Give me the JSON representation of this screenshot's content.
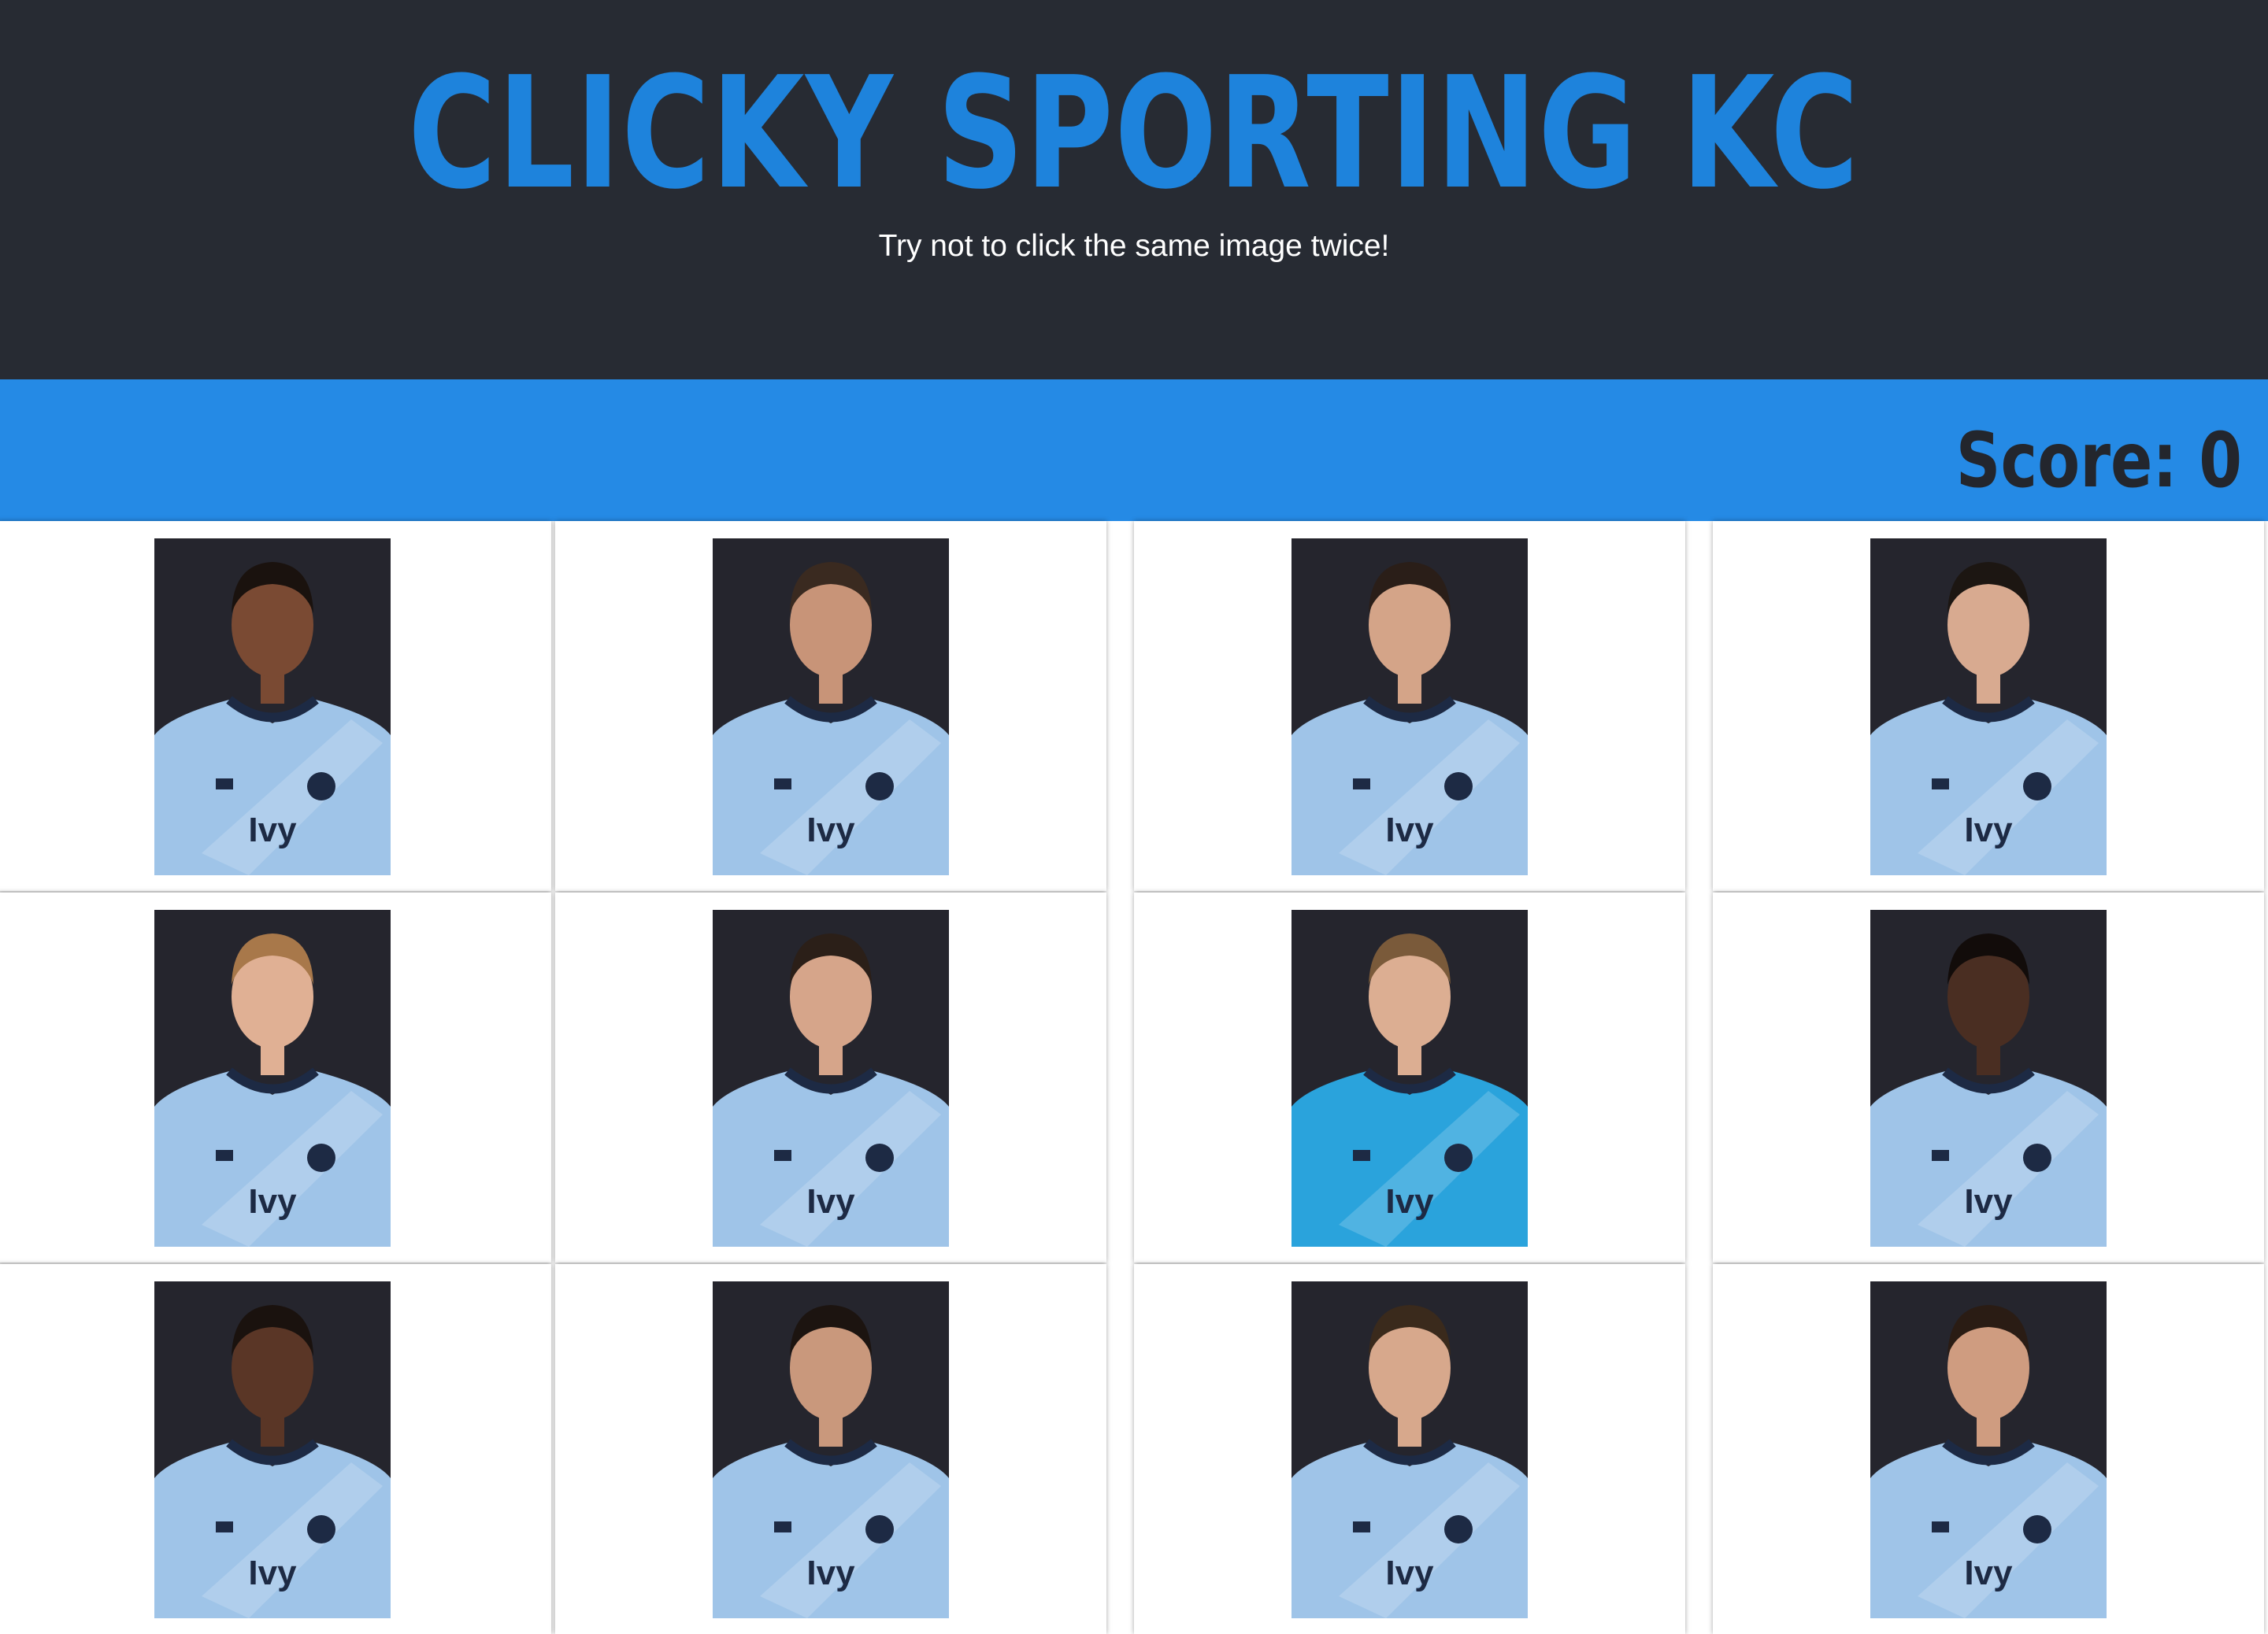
{
  "header": {
    "title": "CLICKY SPORTING KC",
    "subtitle": "Try not to click the same image twice!"
  },
  "scorebar": {
    "score_text": "Score: 0"
  },
  "cards": [
    {
      "name": "player-card",
      "kit": "home"
    },
    {
      "name": "player-card",
      "kit": "home"
    },
    {
      "name": "player-card",
      "kit": "home"
    },
    {
      "name": "player-card",
      "kit": "home"
    },
    {
      "name": "player-card",
      "kit": "home"
    },
    {
      "name": "player-card",
      "kit": "home"
    },
    {
      "name": "player-card",
      "kit": "goalkeeper"
    },
    {
      "name": "player-card",
      "kit": "home"
    },
    {
      "name": "player-card",
      "kit": "home"
    },
    {
      "name": "player-card",
      "kit": "home"
    },
    {
      "name": "player-card",
      "kit": "home"
    },
    {
      "name": "player-card",
      "kit": "home"
    }
  ],
  "colors": {
    "header_bg": "#272b33",
    "title": "#1e83dc",
    "scorebar_bg": "#258ae5",
    "score_text": "#23262d",
    "home_kit": "#9fc4e8",
    "goalkeeper_kit": "#2aa3dc"
  }
}
